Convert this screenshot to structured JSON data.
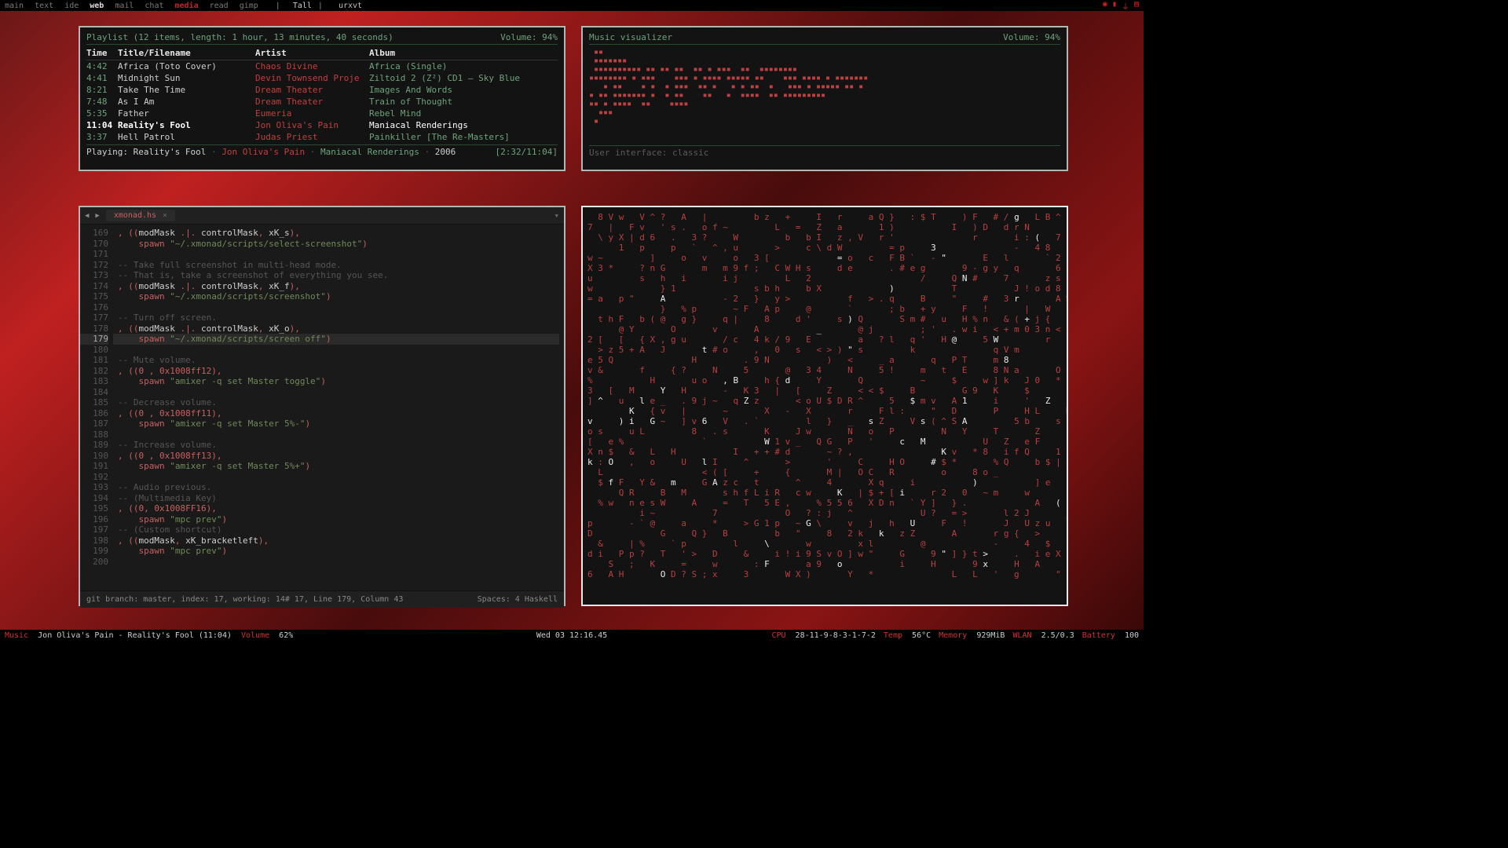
{
  "topbar": {
    "workspaces": [
      "main",
      "text",
      "ide",
      "web",
      "mail",
      "chat",
      "media",
      "read",
      "gimp"
    ],
    "active_index": 6,
    "bold_index": 3,
    "layout": "Tall",
    "title": "urxvt",
    "tray_icons": [
      "◉",
      "▮",
      "⏚",
      "▤"
    ]
  },
  "playlist": {
    "header": "Playlist (12 items, length: 1 hour, 13 minutes, 40 seconds)",
    "volume_label": "Volume: 94%",
    "cols": {
      "time": "Time",
      "title": "Title/Filename",
      "artist": "Artist",
      "album": "Album"
    },
    "rows": [
      {
        "time": "4:42",
        "title": "Africa (Toto Cover)",
        "artist": "Chaos Divine",
        "album": "Africa (Single)"
      },
      {
        "time": "4:41",
        "title": "Midnight Sun",
        "artist": "Devin Townsend Proje",
        "album": "Ziltoid 2 (Z²) CD1 – Sky Blue"
      },
      {
        "time": "8:21",
        "title": "Take The Time",
        "artist": "Dream Theater",
        "album": "Images And Words"
      },
      {
        "time": "7:48",
        "title": "As I Am",
        "artist": "Dream Theater",
        "album": "Train of Thought"
      },
      {
        "time": "5:35",
        "title": "Father",
        "artist": "Eumeria",
        "album": "Rebel Mind"
      },
      {
        "time": "11:04",
        "title": "Reality's Fool",
        "artist": "Jon Oliva's Pain",
        "album": "Maniacal Renderings",
        "selected": true
      },
      {
        "time": "3:37",
        "title": "Hell Patrol",
        "artist": "Judas Priest",
        "album": "Painkiller [The Re-Masters]"
      }
    ],
    "footer": {
      "playing_label": "Playing:",
      "title": "Reality's Fool",
      "artist": "Jon Oliva's Pain",
      "album": "Maniacal Renderings",
      "year": "2006",
      "position": "[2:32/11:04]"
    }
  },
  "visualizer": {
    "header": "Music visualizer",
    "volume_label": "Volume: 94%",
    "footer": "User interface: classic"
  },
  "editor": {
    "tab_name": "xmonad.hs",
    "status_left": "git branch: master, index: 17, working: 14# 17, Line 179, Column 43",
    "status_right": "Spaces: 4 Haskell",
    "first_line": 169,
    "current_line": 179,
    "lines": [
      {
        "n": 169,
        "seg": [
          [
            "",
            ""
          ],
          [
            "sym",
            ", (("
          ],
          [
            "id",
            "modMask "
          ],
          [
            "sym",
            ".|."
          ],
          [
            "id",
            " controlMask"
          ],
          [
            "sym",
            ", "
          ],
          [
            "id",
            "xK_s"
          ],
          [
            "sym",
            "),"
          ]
        ]
      },
      {
        "n": 170,
        "seg": [
          [
            "",
            "    "
          ],
          [
            "kw",
            "spawn"
          ],
          [
            "",
            " "
          ],
          [
            "str",
            "\"~/.xmonad/scripts/select-screenshot\""
          ],
          [
            "sym",
            ")"
          ]
        ]
      },
      {
        "n": 171,
        "seg": []
      },
      {
        "n": 172,
        "seg": [
          [
            "com",
            "-- Take full screenshot in multi-head mode."
          ]
        ]
      },
      {
        "n": 173,
        "seg": [
          [
            "com",
            "-- That is, take a screenshot of everything you see."
          ]
        ]
      },
      {
        "n": 174,
        "seg": [
          [
            "sym",
            ", (("
          ],
          [
            "id",
            "modMask "
          ],
          [
            "sym",
            ".|."
          ],
          [
            "id",
            " controlMask"
          ],
          [
            "sym",
            ", "
          ],
          [
            "id",
            "xK_f"
          ],
          [
            "sym",
            "),"
          ]
        ]
      },
      {
        "n": 175,
        "seg": [
          [
            "",
            "    "
          ],
          [
            "kw",
            "spawn"
          ],
          [
            "",
            " "
          ],
          [
            "str",
            "\"~/.xmonad/scripts/screenshot\""
          ],
          [
            "sym",
            ")"
          ]
        ]
      },
      {
        "n": 176,
        "seg": []
      },
      {
        "n": 177,
        "seg": [
          [
            "com",
            "-- Turn off screen."
          ]
        ]
      },
      {
        "n": 178,
        "seg": [
          [
            "sym",
            ", (("
          ],
          [
            "id",
            "modMask "
          ],
          [
            "sym",
            ".|."
          ],
          [
            "id",
            " controlMask"
          ],
          [
            "sym",
            ", "
          ],
          [
            "id",
            "xK_o"
          ],
          [
            "sym",
            "),"
          ]
        ]
      },
      {
        "n": 179,
        "seg": [
          [
            "",
            "    "
          ],
          [
            "kw",
            "spawn"
          ],
          [
            "",
            " "
          ],
          [
            "str",
            "\"~/.xmonad/scripts/screen off\""
          ],
          [
            "sym",
            ")"
          ]
        ]
      },
      {
        "n": 180,
        "seg": []
      },
      {
        "n": 181,
        "seg": [
          [
            "com",
            "-- Mute volume."
          ]
        ]
      },
      {
        "n": 182,
        "seg": [
          [
            "sym",
            ", (("
          ],
          [
            "kw",
            "0"
          ],
          [
            "",
            " "
          ],
          [
            "sym",
            ","
          ],
          [
            "",
            " "
          ],
          [
            "kw",
            "0x1008ff12"
          ],
          [
            "sym",
            "),"
          ]
        ]
      },
      {
        "n": 183,
        "seg": [
          [
            "",
            "    "
          ],
          [
            "kw",
            "spawn"
          ],
          [
            "",
            " "
          ],
          [
            "str",
            "\"amixer -q set Master toggle\""
          ],
          [
            "sym",
            ")"
          ]
        ]
      },
      {
        "n": 184,
        "seg": []
      },
      {
        "n": 185,
        "seg": [
          [
            "com",
            "-- Decrease volume."
          ]
        ]
      },
      {
        "n": 186,
        "seg": [
          [
            "sym",
            ", (("
          ],
          [
            "kw",
            "0"
          ],
          [
            "",
            " "
          ],
          [
            "sym",
            ","
          ],
          [
            "",
            " "
          ],
          [
            "kw",
            "0x1008ff11"
          ],
          [
            "sym",
            "),"
          ]
        ]
      },
      {
        "n": 187,
        "seg": [
          [
            "",
            "    "
          ],
          [
            "kw",
            "spawn"
          ],
          [
            "",
            " "
          ],
          [
            "str",
            "\"amixer -q set Master 5%-\""
          ],
          [
            "sym",
            ")"
          ]
        ]
      },
      {
        "n": 188,
        "seg": []
      },
      {
        "n": 189,
        "seg": [
          [
            "com",
            "-- Increase volume."
          ]
        ]
      },
      {
        "n": 190,
        "seg": [
          [
            "sym",
            ", (("
          ],
          [
            "kw",
            "0"
          ],
          [
            "",
            " "
          ],
          [
            "sym",
            ","
          ],
          [
            "",
            " "
          ],
          [
            "kw",
            "0x1008ff13"
          ],
          [
            "sym",
            "),"
          ]
        ]
      },
      {
        "n": 191,
        "seg": [
          [
            "",
            "    "
          ],
          [
            "kw",
            "spawn"
          ],
          [
            "",
            " "
          ],
          [
            "str",
            "\"amixer -q set Master 5%+\""
          ],
          [
            "sym",
            ")"
          ]
        ]
      },
      {
        "n": 192,
        "seg": []
      },
      {
        "n": 193,
        "seg": [
          [
            "com",
            "-- Audio previous."
          ]
        ]
      },
      {
        "n": 194,
        "seg": [
          [
            "com",
            "-- (Multimedia Key)"
          ]
        ]
      },
      {
        "n": 195,
        "seg": [
          [
            "sym",
            ", (("
          ],
          [
            "kw",
            "0"
          ],
          [
            "sym",
            ", "
          ],
          [
            "kw",
            "0x1008FF16"
          ],
          [
            "sym",
            "),"
          ]
        ]
      },
      {
        "n": 196,
        "seg": [
          [
            "",
            "    "
          ],
          [
            "kw",
            "spawn"
          ],
          [
            "",
            " "
          ],
          [
            "str",
            "\"mpc prev\""
          ],
          [
            "sym",
            ")"
          ]
        ]
      },
      {
        "n": 197,
        "seg": [
          [
            "com",
            "-- (Custom shortcut)"
          ]
        ]
      },
      {
        "n": 198,
        "seg": [
          [
            "sym",
            ", (("
          ],
          [
            "id",
            "modMask"
          ],
          [
            "sym",
            ", "
          ],
          [
            "id",
            "xK_bracketleft"
          ],
          [
            "sym",
            "),"
          ]
        ]
      },
      {
        "n": 199,
        "seg": [
          [
            "",
            "    "
          ],
          [
            "kw",
            "spawn"
          ],
          [
            "",
            " "
          ],
          [
            "str",
            "\"mpc prev\""
          ],
          [
            "sym",
            ")"
          ]
        ]
      },
      {
        "n": 200,
        "seg": []
      }
    ]
  },
  "bottombar": {
    "music_label": "Music",
    "music_value": "Jon Oliva's Pain - Reality's Fool (11:04)",
    "volume_label": "Volume",
    "volume_value": "62%",
    "clock": "Wed 03 12:16.45",
    "cpu_label": "CPU",
    "cpu_value": "28-11-9-8-3-1-7-2",
    "temp_label": "Temp",
    "temp_value": "56°C",
    "mem_label": "Memory",
    "mem_value": "929MiB",
    "wlan_label": "WLAN",
    "wlan_value": "2.5/0.3",
    "batt_label": "Battery",
    "batt_value": "100"
  }
}
